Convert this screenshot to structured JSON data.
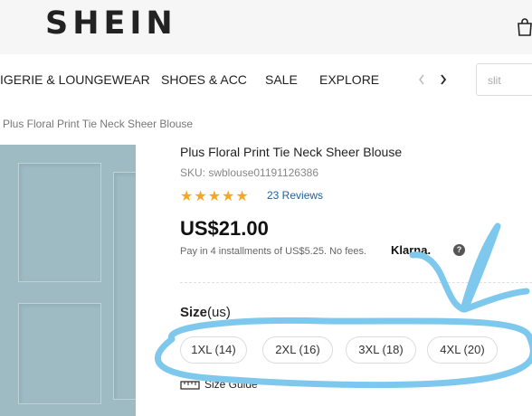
{
  "header": {
    "logo": "SHEIN",
    "icon": "bag-icon"
  },
  "nav": {
    "items": [
      "IGERIE & LOUNGEWEAR",
      "SHOES & ACC",
      "SALE",
      "EXPLORE"
    ],
    "prev_icon": "chevron-left-icon",
    "next_icon": "chevron-right-icon"
  },
  "search": {
    "placeholder": "slit"
  },
  "breadcrumb": "Plus Floral Print Tie Neck Sheer Blouse",
  "product": {
    "title": "Plus Floral Print Tie Neck Sheer Blouse",
    "sku": "SKU: swblouse01191126386",
    "rating": 5,
    "stars": "★★★★★",
    "reviews": "23 Reviews",
    "price": "US$21.00",
    "installments": "Pay in 4 installments of US$5.25. No fees.",
    "klarna": "Klarna.",
    "help": "?",
    "size_label_bold": "Size",
    "size_label_unit": "(us)",
    "sizes": [
      "1XL (14)",
      "2XL (16)",
      "3XL (18)",
      "4XL (20)"
    ],
    "size_guide": "Size Guide"
  },
  "colors": {
    "annotation": "#7ec8ee",
    "star": "#f6a623",
    "link": "#1f5f9e",
    "photo": "#9ebbc4"
  }
}
